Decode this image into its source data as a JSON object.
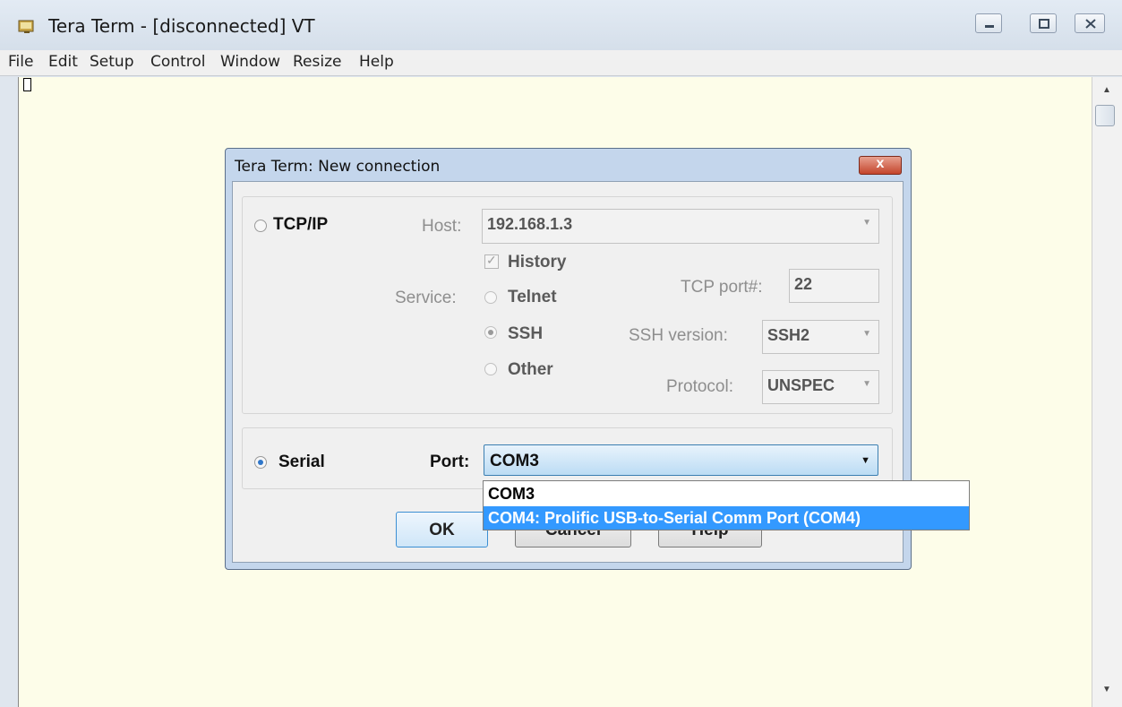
{
  "window": {
    "title": "Tera Term - [disconnected] VT",
    "menu": [
      "File",
      "Edit",
      "Setup",
      "Control",
      "Window",
      "Resize",
      "Help"
    ]
  },
  "dialog": {
    "title": "Tera Term: New connection",
    "close_label": "x",
    "tcpip": {
      "radio_label": "TCP/IP",
      "selected": false,
      "host_label": "Host:",
      "host_value": "192.168.1.3",
      "history_label": "History",
      "history_checked": true,
      "service_label": "Service:",
      "services": [
        "Telnet",
        "SSH",
        "Other"
      ],
      "selected_service": "SSH",
      "tcp_port_label": "TCP port#:",
      "tcp_port_value": "22",
      "ssh_version_label": "SSH version:",
      "ssh_version_value": "SSH2",
      "protocol_label": "Protocol:",
      "protocol_value": "UNSPEC"
    },
    "serial": {
      "radio_label": "Serial",
      "selected": true,
      "port_label": "Port:",
      "port_value": "COM3",
      "port_options": [
        "COM3",
        "COM4: Prolific USB-to-Serial Comm Port (COM4)"
      ],
      "highlighted_option": "COM4: Prolific USB-to-Serial Comm Port (COM4)"
    },
    "buttons": {
      "ok": "OK",
      "cancel": "Cancel",
      "help": "Help"
    }
  },
  "colors": {
    "terminal_bg": "#fdfde9",
    "highlight": "#3399ff",
    "dialog_frame": "#c4d6ec",
    "close_button": "#c4452c"
  }
}
